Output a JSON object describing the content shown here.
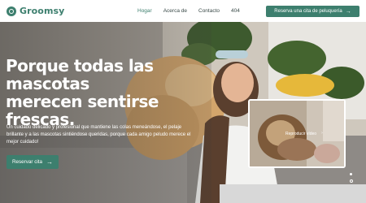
{
  "brand": {
    "name": "Groomsy"
  },
  "nav": {
    "items": [
      {
        "label": "Hogar",
        "active": true
      },
      {
        "label": "Acerca de",
        "active": false
      },
      {
        "label": "Contacto",
        "active": false
      },
      {
        "label": "404",
        "active": false
      }
    ]
  },
  "header_cta": {
    "label": "Reserva una cita de peluquería"
  },
  "hero": {
    "title": "Porque todas las mascotas merecen sentirse frescas.",
    "subtitle": "Un cuidado delicado y profesional que mantiene las colas meneándose, el pelaje brillante y a las mascotas sintiéndose queridas, porque cada amigo peludo merece el mejor cuidado!",
    "cta_label": "Reservar cita"
  },
  "video": {
    "label": "Reproducir vídeo"
  },
  "colors": {
    "accent": "#3d7f6e",
    "text_light": "#ffffff",
    "nav_text": "#3a4a48"
  },
  "icons": [
    "logo-icon",
    "arrow-right-icon",
    "play-icon"
  ]
}
